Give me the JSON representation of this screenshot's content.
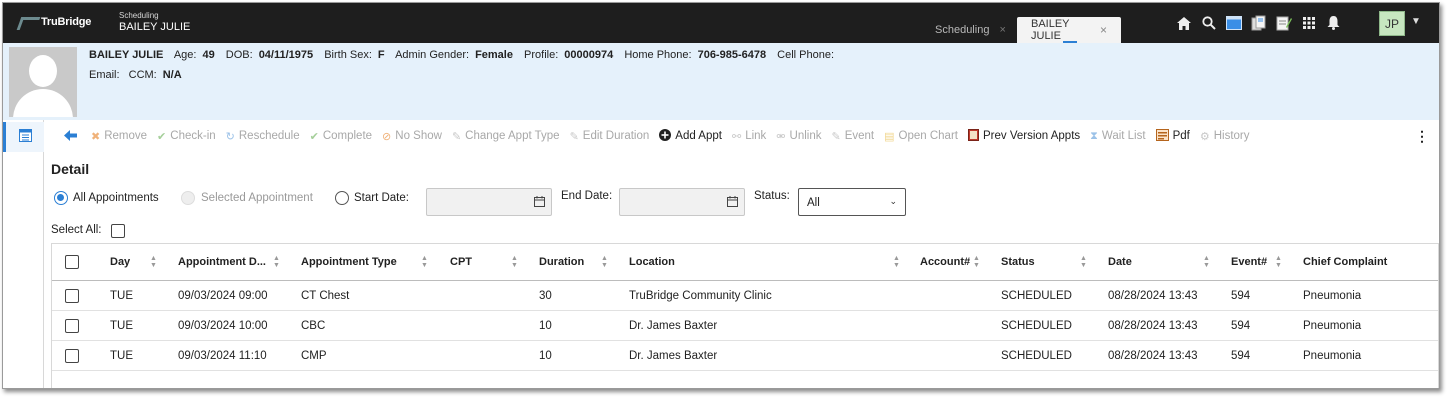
{
  "app": {
    "logo_text": "TruBridge",
    "context_label": "Scheduling",
    "context_name": "BAILEY JULIE"
  },
  "tabs": [
    {
      "label": "Scheduling",
      "close": "×"
    },
    {
      "label": "BAILEY JULIE",
      "close": "×"
    }
  ],
  "header_icons": [
    "home-icon",
    "search-icon",
    "window-icon",
    "documents-icon",
    "notes-icon",
    "apps-grid-icon",
    "bell-icon"
  ],
  "user": {
    "initials": "JP"
  },
  "patient": {
    "name": "BAILEY JULIE",
    "age_label": "Age:",
    "age": "49",
    "dob_label": "DOB:",
    "dob": "04/11/1975",
    "birth_sex_label": "Birth Sex:",
    "birth_sex": "F",
    "admin_gender_label": "Admin Gender:",
    "admin_gender": "Female",
    "profile_label": "Profile:",
    "profile": "00000974",
    "home_phone_label": "Home Phone:",
    "home_phone": "706-985-6478",
    "cell_phone_label": "Cell Phone:",
    "email_label": "Email:",
    "ccm_label": "CCM:",
    "ccm": "N/A"
  },
  "toolbar": {
    "items": [
      {
        "label": "Remove",
        "icon": "remove-icon",
        "enabled": false
      },
      {
        "label": "Check-in",
        "icon": "check-in-icon",
        "enabled": false
      },
      {
        "label": "Reschedule",
        "icon": "reschedule-icon",
        "enabled": false
      },
      {
        "label": "Complete",
        "icon": "complete-icon",
        "enabled": false
      },
      {
        "label": "No Show",
        "icon": "no-show-icon",
        "enabled": false
      },
      {
        "label": "Change Appt Type",
        "icon": "change-type-icon",
        "enabled": false
      },
      {
        "label": "Edit Duration",
        "icon": "edit-duration-icon",
        "enabled": false
      },
      {
        "label": "Add Appt",
        "icon": "add-icon",
        "enabled": true
      },
      {
        "label": "Link",
        "icon": "link-icon",
        "enabled": false
      },
      {
        "label": "Unlink",
        "icon": "unlink-icon",
        "enabled": false
      },
      {
        "label": "Event",
        "icon": "event-icon",
        "enabled": false
      },
      {
        "label": "Open Chart",
        "icon": "chart-icon",
        "enabled": false
      },
      {
        "label": "Prev Version Appts",
        "icon": "prev-version-icon",
        "enabled": true
      },
      {
        "label": "Wait List",
        "icon": "hourglass-icon",
        "enabled": false
      },
      {
        "label": "Pdf",
        "icon": "pdf-icon",
        "enabled": true
      },
      {
        "label": "History",
        "icon": "history-icon",
        "enabled": false
      }
    ]
  },
  "detail": {
    "title": "Detail",
    "radio_all": "All Appointments",
    "radio_selected": "Selected Appointment",
    "radio_start": "Start Date:",
    "end_date_label": "End Date:",
    "status_label": "Status:",
    "status_value": "All",
    "select_all_label": "Select All:"
  },
  "table": {
    "columns": [
      "Day",
      "Appointment D...",
      "Appointment Type",
      "CPT",
      "Duration",
      "Location",
      "Account#",
      "Status",
      "Date",
      "Event#",
      "Chief Complaint"
    ],
    "rows": [
      [
        "TUE",
        "09/03/2024 09:00",
        "CT Chest",
        "",
        "30",
        "TruBridge Community Clinic",
        "",
        "SCHEDULED",
        "08/28/2024 13:43",
        "594",
        "Pneumonia"
      ],
      [
        "TUE",
        "09/03/2024 10:00",
        "CBC",
        "",
        "10",
        "Dr. James Baxter",
        "",
        "SCHEDULED",
        "08/28/2024 13:43",
        "594",
        "Pneumonia"
      ],
      [
        "TUE",
        "09/03/2024 11:10",
        "CMP",
        "",
        "10",
        "Dr. James Baxter",
        "",
        "SCHEDULED",
        "08/28/2024 13:43",
        "594",
        "Pneumonia"
      ]
    ]
  }
}
